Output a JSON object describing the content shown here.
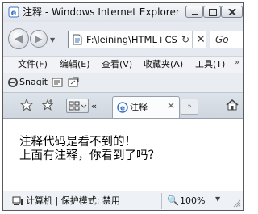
{
  "window": {
    "title": "注释 - Windows Internet Explorer"
  },
  "nav": {
    "back_icon": "back-arrow-icon",
    "forward_icon": "forward-arrow-icon",
    "address": "F:\\leining\\HTML+CSS",
    "search_placeholder": "Go"
  },
  "menu": {
    "items": [
      "文件(F)",
      "编辑(E)",
      "查看(V)",
      "收藏夹(A)",
      "工具(T)"
    ]
  },
  "snagit": {
    "label": "Snagit"
  },
  "tabs": {
    "active_label": "注释",
    "new_tab_label": "»"
  },
  "content": {
    "line1": "注释代码是看不到的！",
    "line2": "上面有注释，你看到了吗？"
  },
  "status": {
    "zone": "计算机 | 保护模式: 禁用",
    "zoom": "100%"
  },
  "colors": {
    "chrome": "#e6eaf0",
    "accent": "#3a73c4"
  }
}
